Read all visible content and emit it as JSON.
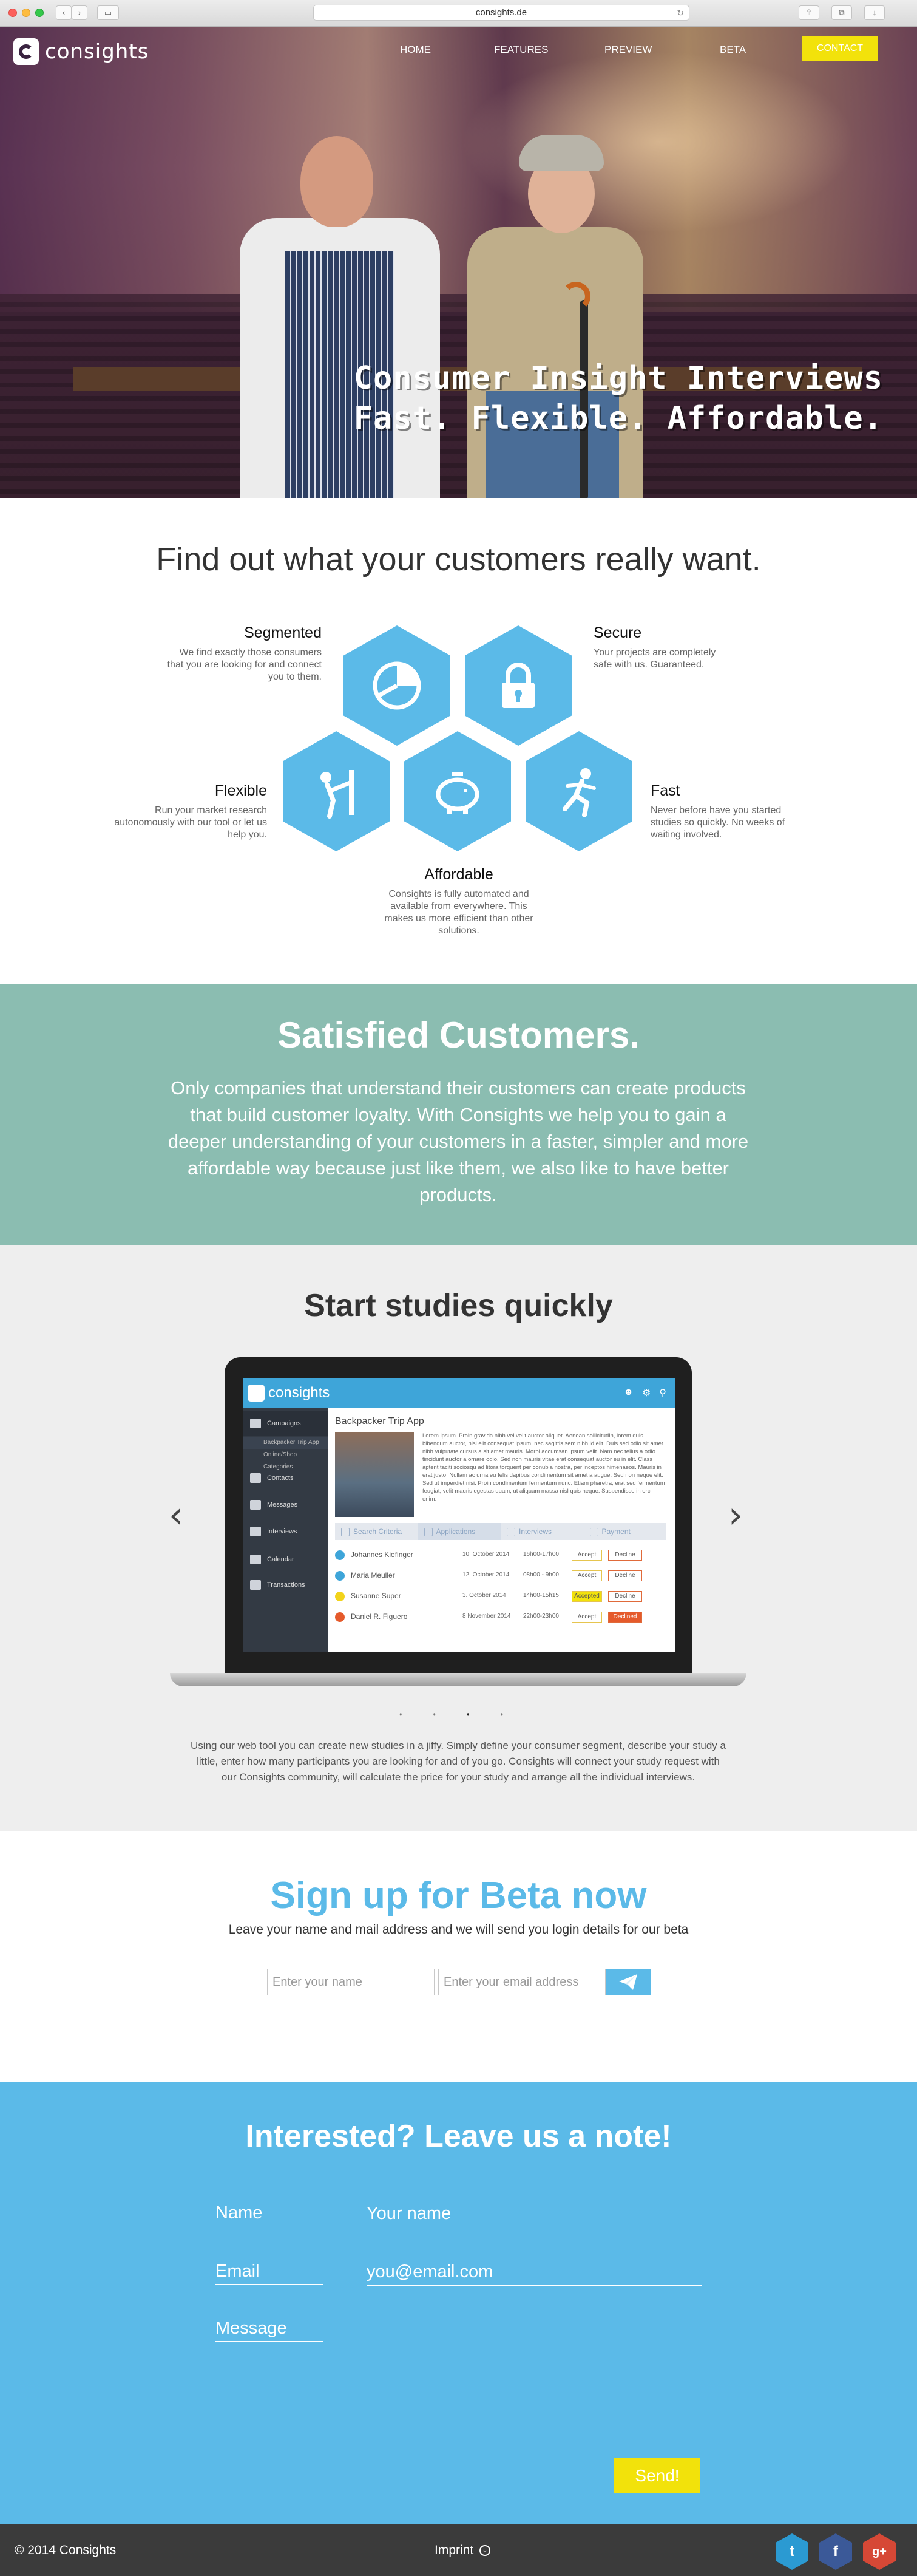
{
  "browser": {
    "url": "consights.de"
  },
  "header": {
    "logo_text": "consights",
    "nav": [
      "HOME",
      "FEATURES",
      "PREVIEW",
      "BETA"
    ],
    "contact": "CONTACT"
  },
  "hero": {
    "title_line1": "Consumer Insight Interviews",
    "title_line2": "Fast. Flexible. Affordable."
  },
  "features": {
    "heading": "Find out what your customers really want.",
    "items": [
      {
        "title": "Segmented",
        "text": "We find exactly those consumers that you are looking for and connect you to them.",
        "icon": "pie-chart-icon"
      },
      {
        "title": "Secure",
        "text": "Your projects are completely safe with us. Guaranteed.",
        "icon": "lock-icon"
      },
      {
        "title": "Flexible",
        "text": "Run your market research autonomously with our tool or let us help you.",
        "icon": "stretching-person-icon"
      },
      {
        "title": "Fast",
        "text": "Never before have you started studies so quickly. No weeks of waiting involved.",
        "icon": "running-person-icon"
      },
      {
        "title": "Affordable",
        "text": "Consights is fully automated and available from everywhere. This makes us more efficient than other solutions.",
        "icon": "piggy-bank-icon"
      }
    ]
  },
  "satisfied": {
    "title": "Satisfied Customers.",
    "text": "Only companies that understand their customers can create products that build customer loyalty. With Consights we help you to gain a deeper understanding of your customers in a faster, simpler and more affordable way because just like them, we also like to have better products."
  },
  "studies": {
    "title": "Start studies quickly",
    "text": "Using our web tool you can create new studies in a jiffy. Simply define your consumer segment, describe your study a little, enter how many participants you are looking for and of you go. Consights will connect your study request with our Consights community, will calculate the price for your study and arrange all the individual interviews.",
    "carousel_dots": [
      "•",
      "•",
      "•",
      "•"
    ],
    "app": {
      "logo_text": "consights",
      "sidebar": [
        {
          "label": "Campaigns",
          "sub": [
            "Backpacker Trip App",
            "Online/Shop Categories"
          ]
        },
        {
          "label": "Contacts"
        },
        {
          "label": "Messages"
        },
        {
          "label": "Interviews"
        },
        {
          "label": "Calendar"
        },
        {
          "label": "Transactions"
        }
      ],
      "project_title": "Backpacker Trip App",
      "lorem": "Lorem ipsum. Proin gravida nibh vel velit auctor aliquet. Aenean sollicitudin, lorem quis bibendum auctor, nisi elit consequat ipsum, nec sagittis sem nibh id elit. Duis sed odio sit amet nibh vulputate cursus a sit amet mauris. Morbi accumsan ipsum velit. Nam nec tellus a odio tincidunt auctor a ornare odio. Sed non mauris vitae erat consequat auctor eu in elit. Class aptent taciti sociosqu ad litora torquent per conubia nostra, per inceptos himenaeos. Mauris in erat justo. Nullam ac urna eu felis dapibus condimentum sit amet a augue. Sed non neque elit. Sed ut imperdiet nisi. Proin condimentum fermentum nunc. Etiam pharetra, erat sed fermentum feugiat, velit mauris egestas quam, ut aliquam massa nisl quis neque. Suspendisse in orci enim.",
      "tabs": [
        "Search Criteria",
        "Applications",
        "Interviews",
        "Payment"
      ],
      "rows": [
        {
          "name": "Johannes Kiefinger",
          "date": "10. October 2014",
          "time": "16h00-17h00",
          "b1": "Accept",
          "b2": "Decline",
          "color": "#3ea5d9"
        },
        {
          "name": "Maria Meuller",
          "date": "12. October 2014",
          "time": "08h00 - 9h00",
          "b1": "Accept",
          "b2": "Decline",
          "color": "#3ea5d9"
        },
        {
          "name": "Susanne Super",
          "date": "3. October 2014",
          "time": "14h00-15h15",
          "b1": "Accepted",
          "b2": "Decline",
          "color": "#f2d31b"
        },
        {
          "name": "Daniel R. Figuero",
          "date": "8 November 2014",
          "time": "22h00-23h00",
          "b1": "Accept",
          "b2": "Declined",
          "color": "#e55a2b"
        }
      ]
    }
  },
  "signup": {
    "title": "Sign up for Beta now",
    "subtitle": "Leave your name and mail address and we will send you login details for our beta",
    "name_placeholder": "Enter your name",
    "email_placeholder": "Enter your email address"
  },
  "contact": {
    "title": "Interested? Leave us a note!",
    "name_label": "Name",
    "name_placeholder": "Your name",
    "email_label": "Email",
    "email_placeholder": "you@email.com",
    "message_label": "Message",
    "send": "Send!"
  },
  "footer": {
    "copyright": "© 2014 Consights",
    "imprint": "Imprint",
    "social": [
      "twitter",
      "facebook",
      "google-plus"
    ]
  },
  "colors": {
    "accent_blue": "#5bbae8",
    "teal": "#8bbdb1",
    "yellow": "#f2e20b",
    "footer": "#3b3b3b"
  }
}
